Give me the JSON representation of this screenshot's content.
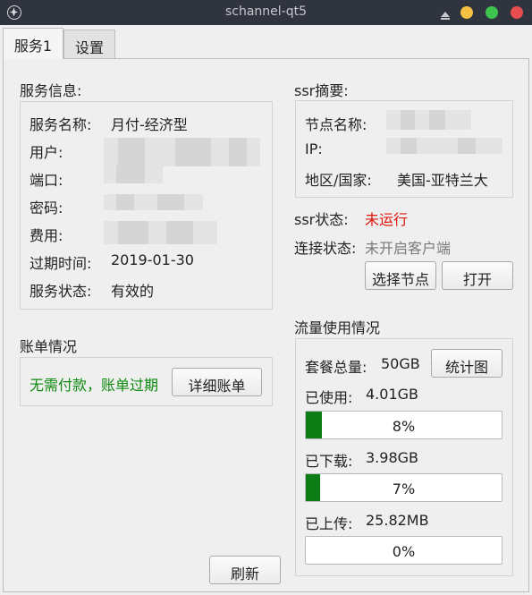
{
  "window": {
    "title": "schannel-qt5"
  },
  "tabs": [
    {
      "label": "服务1"
    },
    {
      "label": "设置"
    }
  ],
  "service": {
    "section_title": "服务信息:",
    "name_label": "服务名称:",
    "name_value": "月付-经济型",
    "user_label": "用户:",
    "port_label": "端口:",
    "password_label": "密码:",
    "fee_label": "费用:",
    "expiry_label": "过期时间:",
    "expiry_value": "2019-01-30",
    "status_label": "服务状态:",
    "status_value": "有效的"
  },
  "bill": {
    "section_title": "账单情况",
    "status": "无需付款，账单过期",
    "detail_button": "详细账单"
  },
  "refresh_button": "刷新",
  "ssr": {
    "section_title": "ssr摘要:",
    "node_label": "节点名称:",
    "ip_label": "IP:",
    "region_label": "地区/国家:",
    "region_value": "美国-亚特兰大",
    "state_label": "ssr状态:",
    "state_value": "未运行",
    "conn_label": "连接状态:",
    "conn_value": "未开启客户端",
    "select_node_button": "选择节点",
    "open_button": "打开"
  },
  "traffic": {
    "section_title": "流量使用情况",
    "total_label": "套餐总量:",
    "total_value": "50GB",
    "chart_button": "统计图",
    "used_label": "已使用:",
    "used_value": "4.01GB",
    "used_pct": 8,
    "used_pct_text": "8%",
    "down_label": "已下载:",
    "down_value": "3.98GB",
    "down_pct": 7,
    "down_pct_text": "7%",
    "up_label": "已上传:",
    "up_value": "25.82MB",
    "up_pct": 0,
    "up_pct_text": "0%"
  },
  "colors": {
    "titlebar": "#2f343f",
    "progress_fill": "#0b7d14",
    "error_text": "#e0140e",
    "ok_text": "#0d8a0d"
  }
}
